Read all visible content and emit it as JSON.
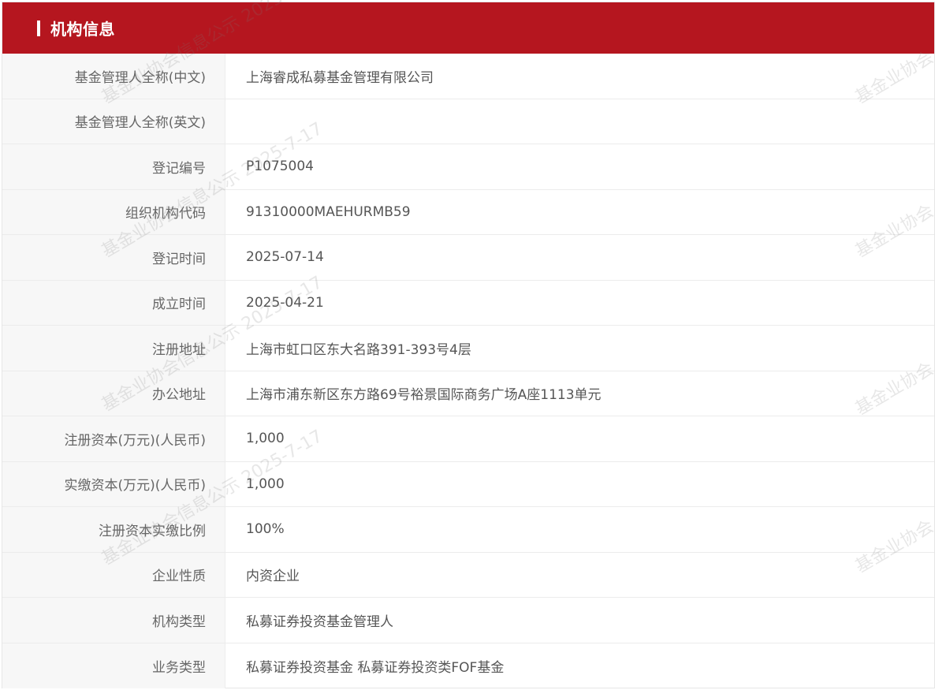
{
  "header": {
    "title": "机构信息"
  },
  "rows": [
    {
      "label": "基金管理人全称(中文)",
      "value": "上海睿成私募基金管理有限公司"
    },
    {
      "label": "基金管理人全称(英文)",
      "value": ""
    },
    {
      "label": "登记编号",
      "value": "P1075004"
    },
    {
      "label": "组织机构代码",
      "value": "91310000MAEHURMB59"
    },
    {
      "label": "登记时间",
      "value": "2025-07-14"
    },
    {
      "label": "成立时间",
      "value": "2025-04-21"
    },
    {
      "label": "注册地址",
      "value": "上海市虹口区东大名路391-393号4层"
    },
    {
      "label": "办公地址",
      "value": "上海市浦东新区东方路69号裕景国际商务广场A座1113单元"
    },
    {
      "label": "注册资本(万元)(人民币)",
      "value": "1,000"
    },
    {
      "label": "实缴资本(万元)(人民币)",
      "value": "1,000"
    },
    {
      "label": "注册资本实缴比例",
      "value": "100%"
    },
    {
      "label": "企业性质",
      "value": "内资企业"
    },
    {
      "label": "机构类型",
      "value": "私募证券投资基金管理人"
    },
    {
      "label": "业务类型",
      "value": "私募证券投资基金 私募证券投资类FOF基金"
    }
  ],
  "watermark": {
    "text": "基金业协会信息公示 2025-7-17",
    "partial_text": "基金业协会"
  },
  "colors": {
    "header_bg": "#b5161f",
    "label_bg": "#f7f7f7"
  }
}
